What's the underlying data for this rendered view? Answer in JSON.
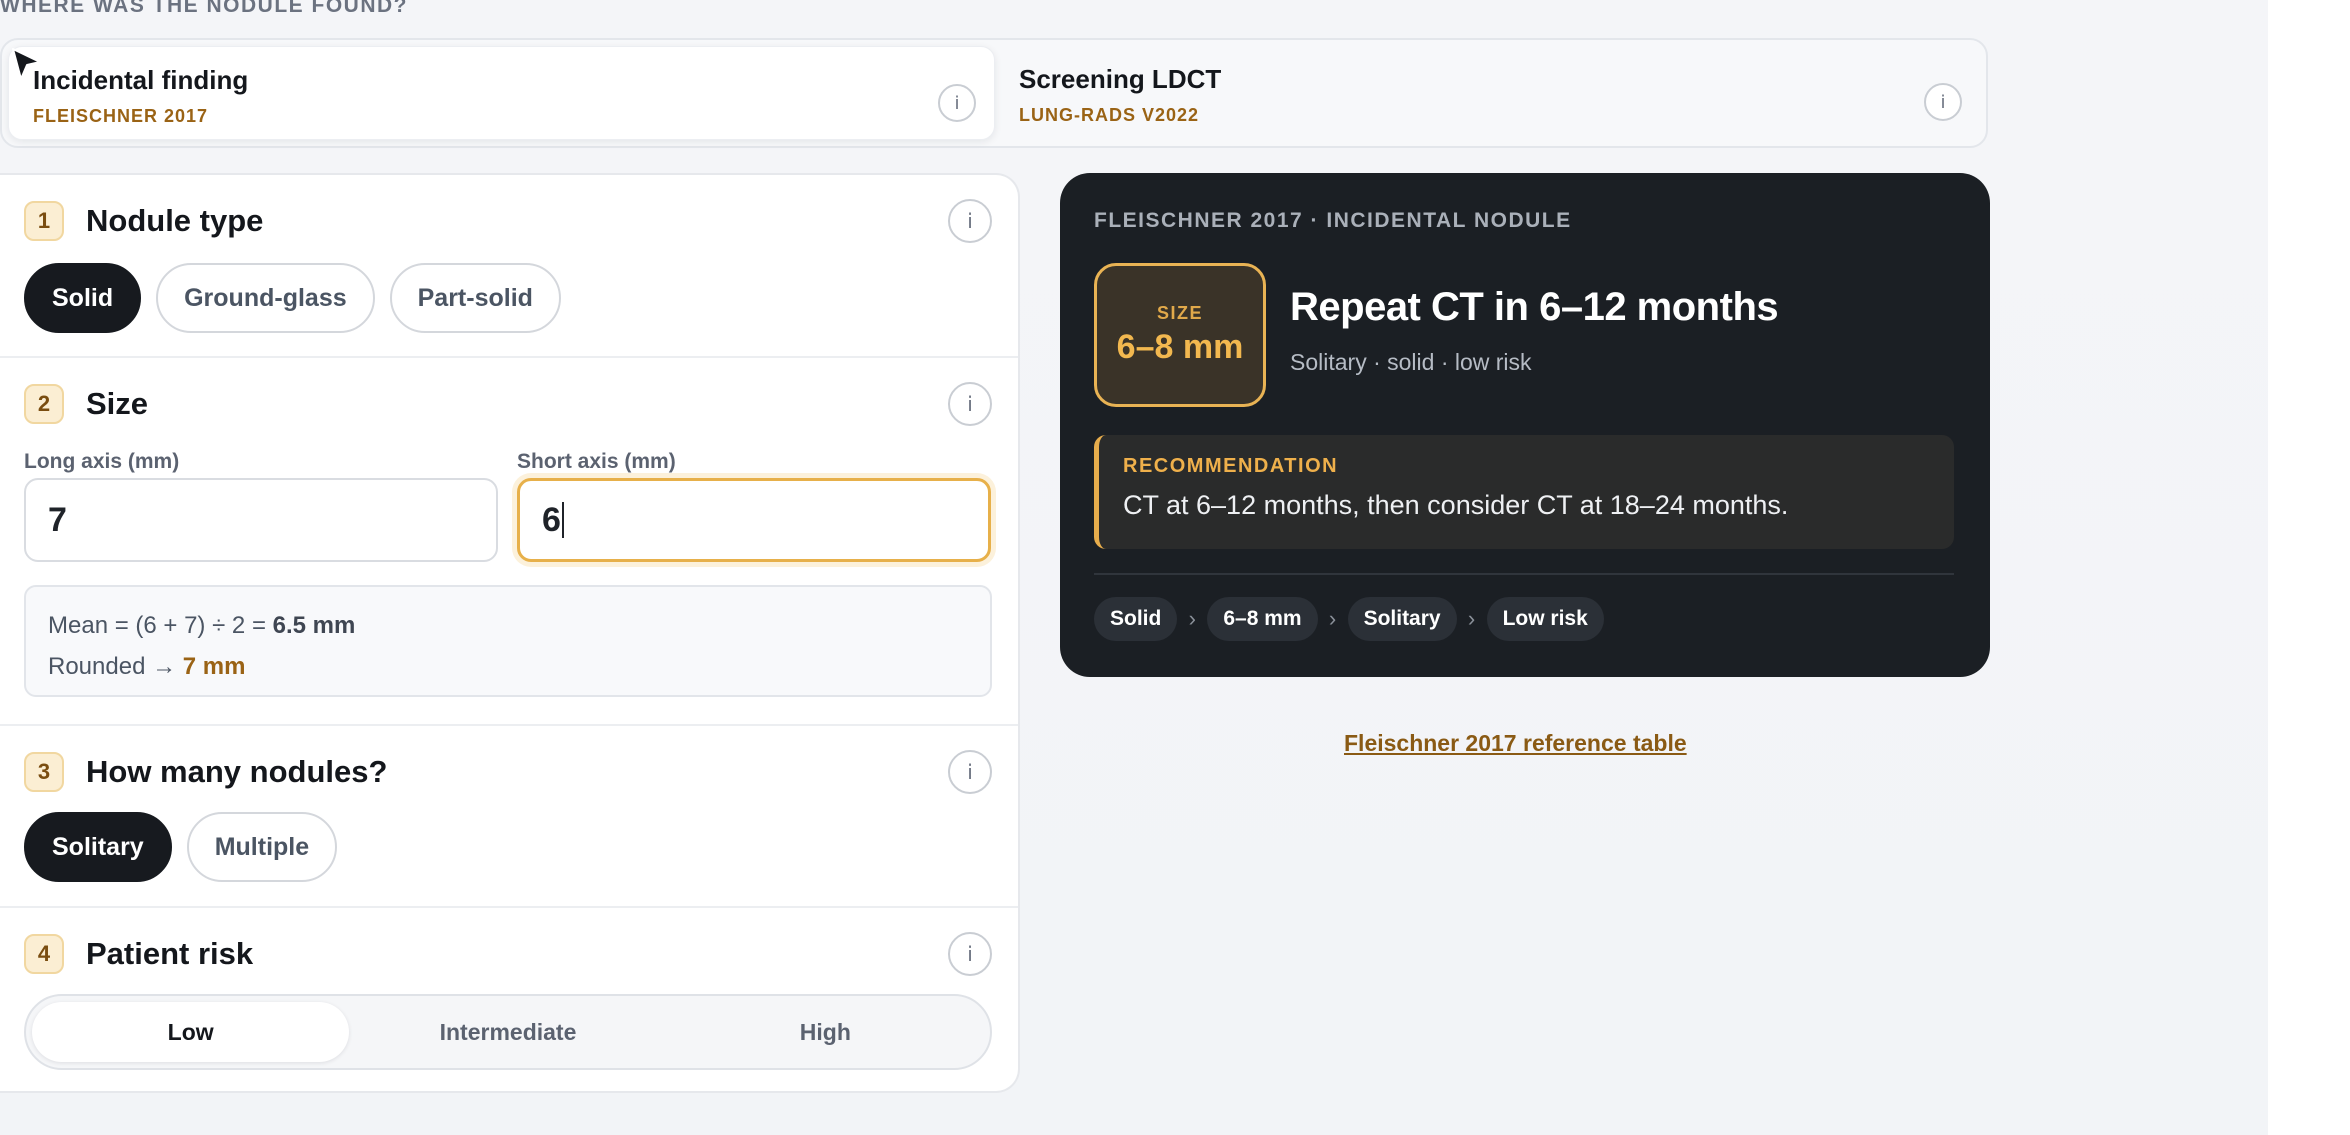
{
  "section_label": "WHERE WAS THE NODULE FOUND?",
  "modes": [
    {
      "title": "Incidental finding",
      "subtitle": "FLEISCHNER 2017",
      "active": true
    },
    {
      "title": "Screening LDCT",
      "subtitle": "LUNG-RADS V2022",
      "active": false
    }
  ],
  "info_glyph": "i",
  "steps": {
    "type": {
      "num": "1",
      "title": "Nodule type",
      "options": [
        "Solid",
        "Ground-glass",
        "Part-solid"
      ],
      "selected": "Solid"
    },
    "size": {
      "num": "2",
      "title": "Size",
      "long_label": "Long axis (mm)",
      "long_value": "7",
      "short_label": "Short axis (mm)",
      "short_value": "6",
      "mean_prefix": "Mean = (6 + 7) ÷ 2 = ",
      "mean_value": "6.5 mm",
      "rounded_prefix": "Rounded → ",
      "rounded_value": "7 mm"
    },
    "count": {
      "num": "3",
      "title": "How many nodules?",
      "options": [
        "Solitary",
        "Multiple"
      ],
      "selected": "Solitary"
    },
    "risk": {
      "num": "4",
      "title": "Patient risk",
      "options": [
        "Low",
        "Intermediate",
        "High"
      ],
      "selected": "Low"
    }
  },
  "result": {
    "kicker": "FLEISCHNER 2017 · INCIDENTAL NODULE",
    "size_label": "SIZE",
    "size_value": "6–8 mm",
    "title": "Repeat CT in 6–12 months",
    "subtitle": "Solitary · solid · low risk",
    "rec_label": "RECOMMENDATION",
    "rec_text": "CT at 6–12 months, then consider CT at 18–24 months.",
    "crumbs": [
      "Solid",
      "6–8 mm",
      "Solitary",
      "Low risk"
    ],
    "crumb_sep": "›"
  },
  "reference_link": "Fleischner 2017 reference table",
  "colors": {
    "accent": "#e7b04a",
    "dark_card": "#1b1f24",
    "link": "#8a5a14"
  }
}
